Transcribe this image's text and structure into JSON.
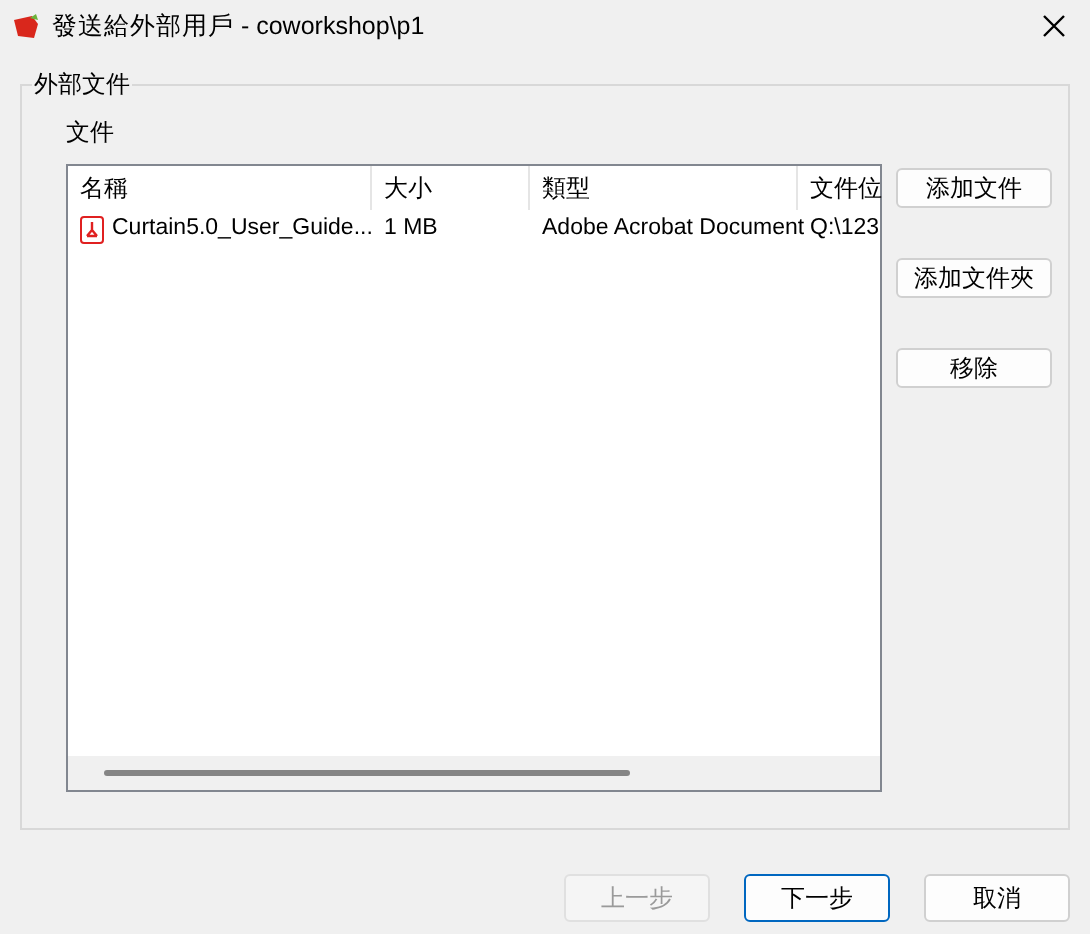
{
  "window": {
    "title": "發送給外部用戶 - coworkshop\\p1"
  },
  "group": {
    "title": "外部文件",
    "list_label": "文件"
  },
  "table": {
    "columns": [
      "名稱",
      "大小",
      "類型",
      "文件位"
    ],
    "rows": [
      {
        "kind": "pdf",
        "cells": [
          "Curtain5.0_User_Guide...",
          "1 MB",
          "Adobe Acrobat Document",
          "Q:\\123"
        ]
      }
    ]
  },
  "side_buttons": [
    "添加文件",
    "添加文件夾",
    "移除"
  ],
  "footer_buttons": [
    {
      "label": "上一步",
      "disabled": true,
      "default": false
    },
    {
      "label": "下一步",
      "disabled": false,
      "default": true
    },
    {
      "label": "取消",
      "disabled": false,
      "default": false
    }
  ]
}
